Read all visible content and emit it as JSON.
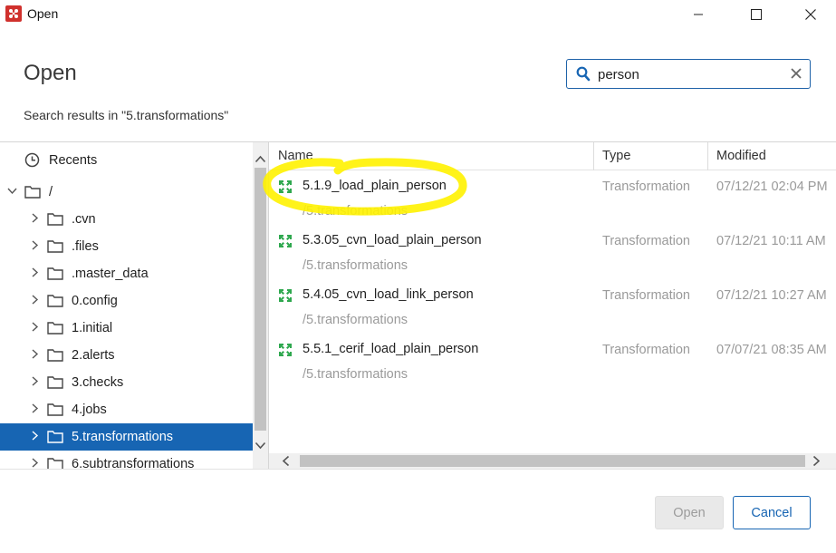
{
  "window": {
    "title": "Open",
    "app_icon": "pentaho-app-icon",
    "controls": [
      "minimize-icon",
      "maximize-icon",
      "close-icon"
    ]
  },
  "header": {
    "heading": "Open",
    "search": {
      "value": "person",
      "icon": "search-icon",
      "clear_icon": "clear-icon"
    },
    "results_label": "Search results in \"5.transformations\""
  },
  "tree": {
    "recents_label": "Recents",
    "root_label": "/",
    "folders": [
      {
        "label": ".cvn"
      },
      {
        "label": ".files"
      },
      {
        "label": ".master_data"
      },
      {
        "label": "0.config"
      },
      {
        "label": "1.initial"
      },
      {
        "label": "2.alerts"
      },
      {
        "label": "3.checks"
      },
      {
        "label": "4.jobs"
      },
      {
        "label": "5.transformations",
        "selected": true
      },
      {
        "label": "6.subtransformations"
      }
    ]
  },
  "table": {
    "columns": {
      "name": "Name",
      "type": "Type",
      "modified": "Modified"
    },
    "rows": [
      {
        "name": "5.1.9_load_plain_person",
        "path": "/5.transformations",
        "type": "Transformation",
        "modified": "07/12/21 02:04 PM",
        "highlighted": true
      },
      {
        "name": "5.3.05_cvn_load_plain_person",
        "path": "/5.transformations",
        "type": "Transformation",
        "modified": "07/12/21 10:11 AM"
      },
      {
        "name": "5.4.05_cvn_load_link_person",
        "path": "/5.transformations",
        "type": "Transformation",
        "modified": "07/12/21 10:27 AM"
      },
      {
        "name": "5.5.1_cerif_load_plain_person",
        "path": "/5.transformations",
        "type": "Transformation",
        "modified": "07/07/21 08:35 AM"
      }
    ]
  },
  "footer": {
    "open_label": "Open",
    "cancel_label": "Cancel"
  },
  "colors": {
    "accent": "#1765b3",
    "selected_row": "#1765b3",
    "highlight": "#fff200",
    "transformation_icon": "#2fa84f"
  }
}
